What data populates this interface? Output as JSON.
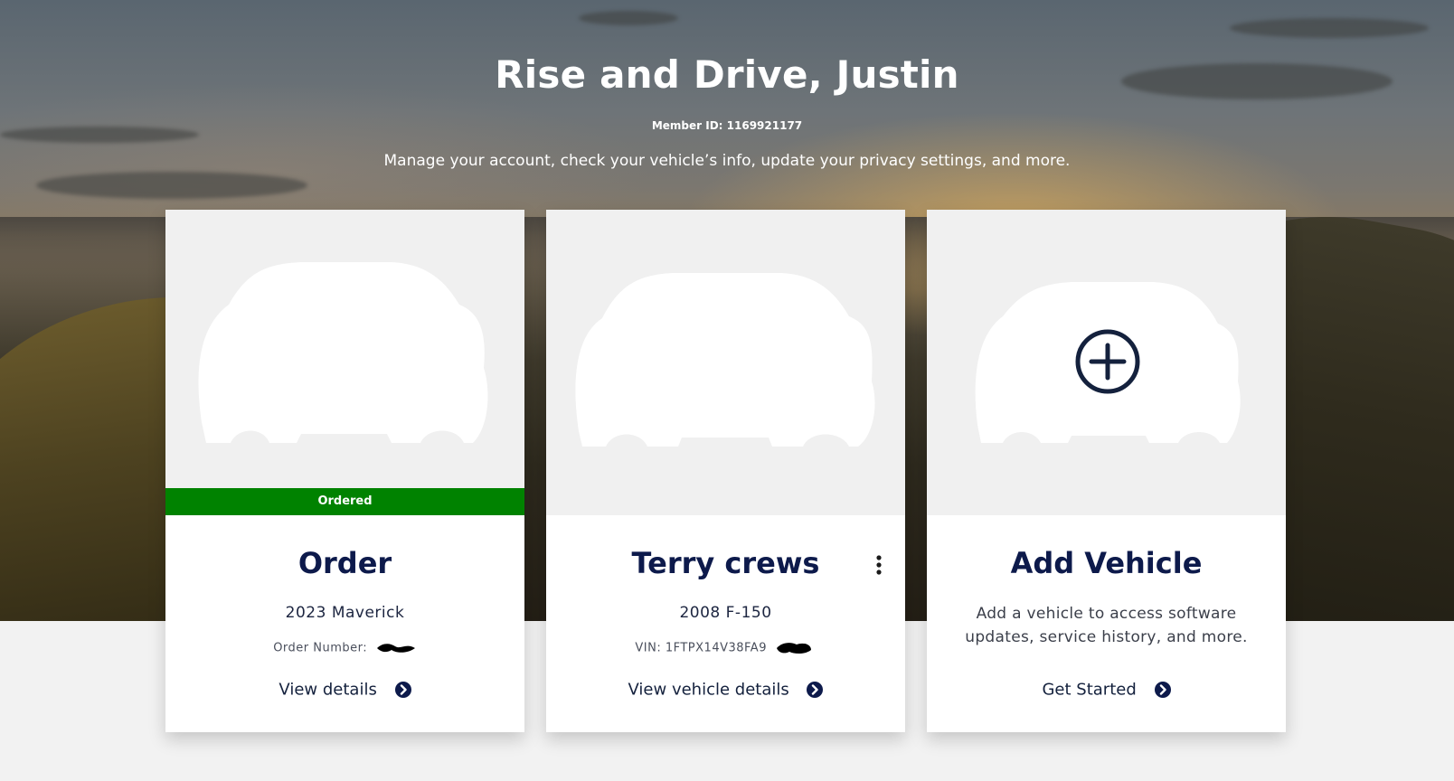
{
  "header": {
    "title": "Rise and Drive, Justin",
    "member_id": "Member ID: 1169921177",
    "subtitle": "Manage your account, check your vehicle’s info, update your privacy settings, and more."
  },
  "cards": [
    {
      "status": "Ordered",
      "heading": "Order",
      "model": "2023 Maverick",
      "meta_label": "Order Number:",
      "action": "View details",
      "status_color": "#008200"
    },
    {
      "heading": "Terry crews",
      "model": "2008 F-150",
      "meta_label": "VIN: 1FTPX14V38FA9",
      "action": "View vehicle details"
    },
    {
      "heading": "Add Vehicle",
      "description": "Add a vehicle to access software updates, service history, and more.",
      "action": "Get Started"
    }
  ],
  "colors": {
    "brand_navy": "#0d1a4b",
    "status_green": "#008200",
    "page_bg": "#f2f2f2"
  },
  "icons": {
    "action_arrow": "circle-arrow-right-icon",
    "add": "plus-circle-icon",
    "menu": "kebab-menu-icon"
  }
}
